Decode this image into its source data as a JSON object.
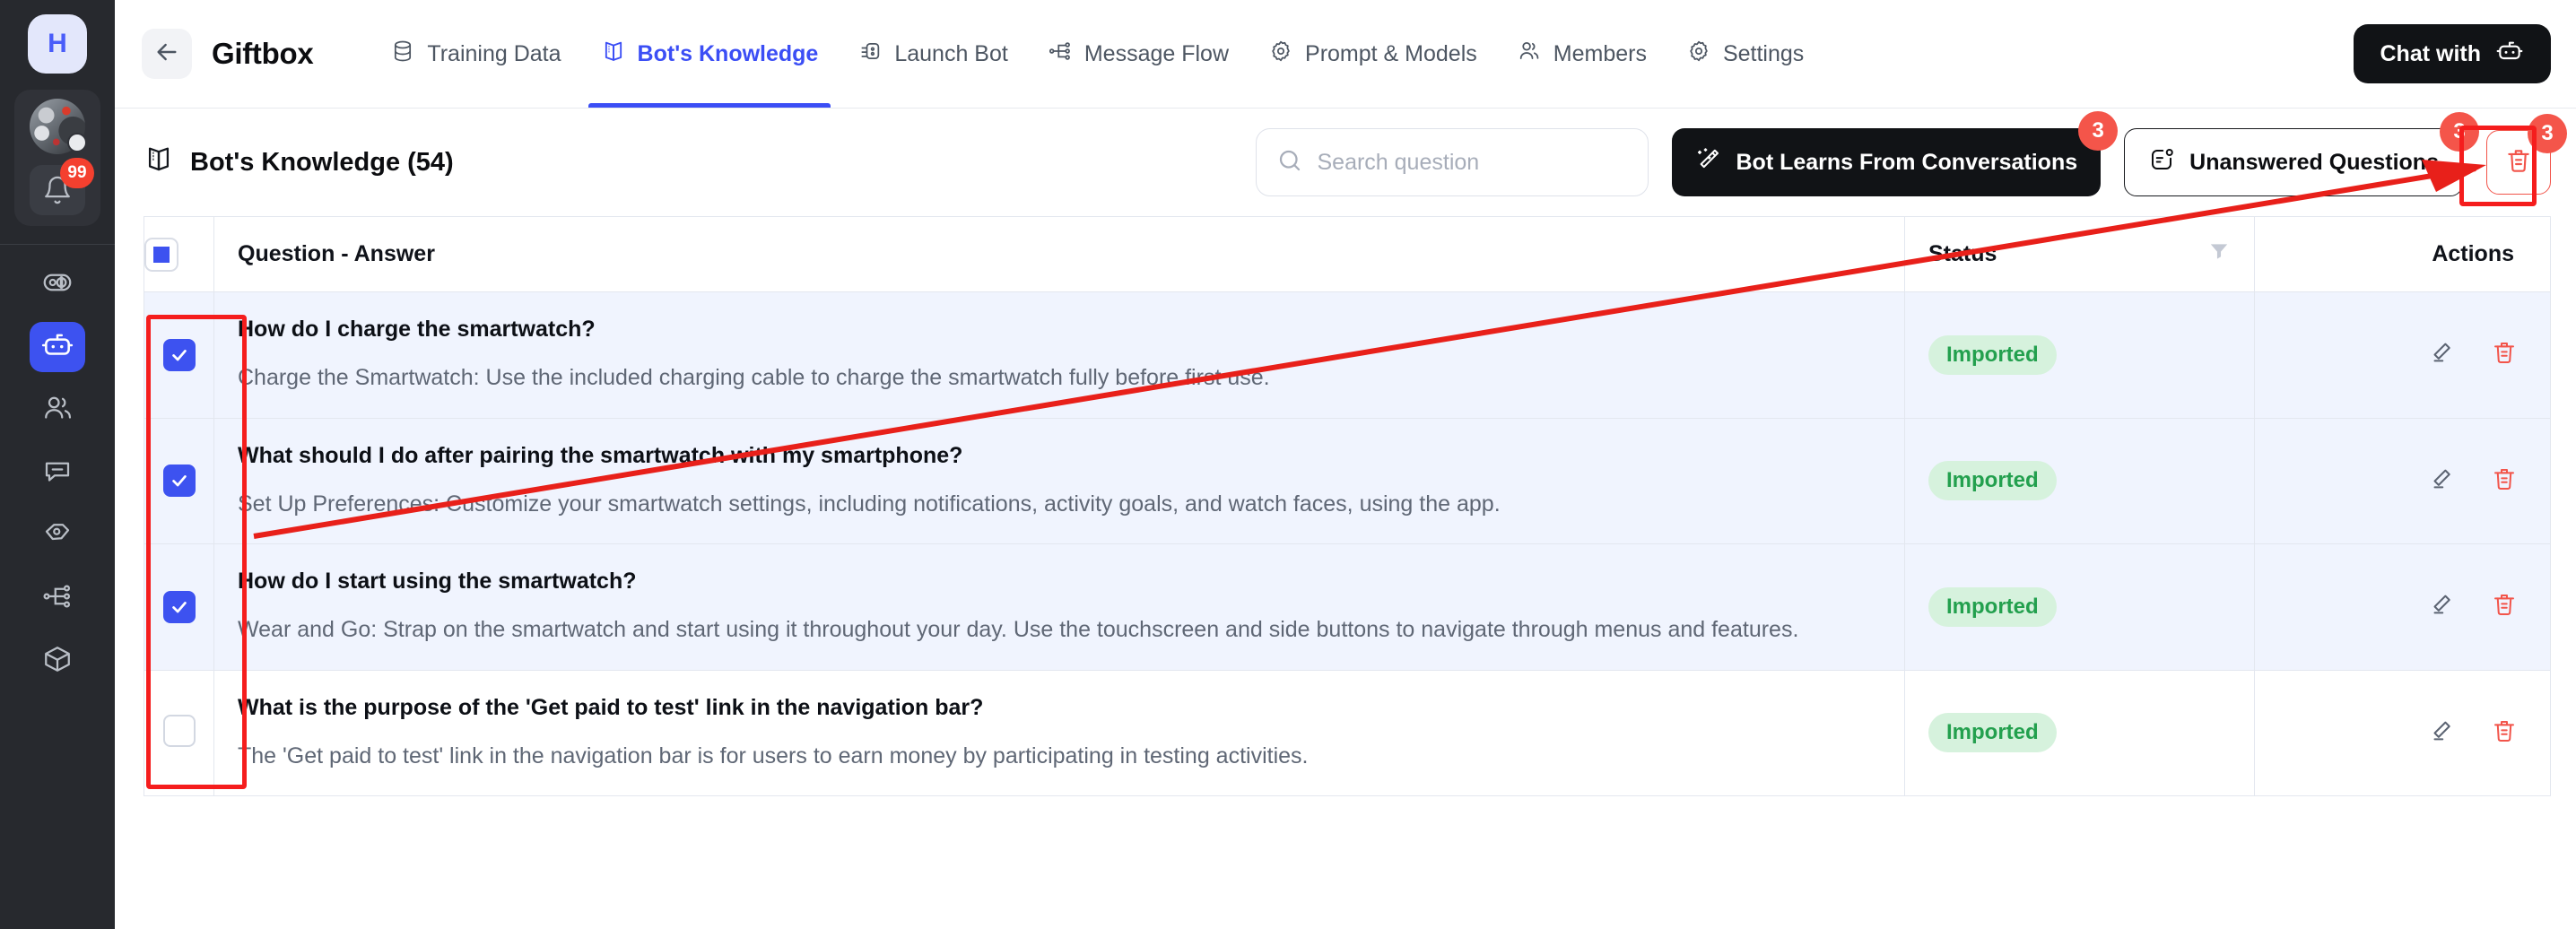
{
  "rail": {
    "logo_letter": "H",
    "notification_count": "99",
    "items": [
      {
        "name": "dashboard",
        "icon": "gauge-icon"
      },
      {
        "name": "bots",
        "icon": "robot-icon",
        "active": true
      },
      {
        "name": "contacts",
        "icon": "users-icon"
      },
      {
        "name": "conversations",
        "icon": "chat-bubble-icon"
      },
      {
        "name": "tags",
        "icon": "tag-icon"
      },
      {
        "name": "flows",
        "icon": "flow-icon"
      },
      {
        "name": "integrations",
        "icon": "box-icon"
      }
    ]
  },
  "topbar": {
    "back_label": "back-arrow",
    "brand": "Giftbox",
    "tabs": [
      {
        "label": "Training Data",
        "icon": "database-icon",
        "active": false
      },
      {
        "label": "Bot's Knowledge",
        "icon": "book-icon",
        "active": true
      },
      {
        "label": "Launch Bot",
        "icon": "launch-bot-icon",
        "active": false
      },
      {
        "label": "Message Flow",
        "icon": "flow-icon",
        "active": false
      },
      {
        "label": "Prompt & Models",
        "icon": "gear-icon",
        "active": false
      },
      {
        "label": "Members",
        "icon": "users-icon",
        "active": false
      },
      {
        "label": "Settings",
        "icon": "gear-icon",
        "active": false
      }
    ],
    "chat_button": "Chat with"
  },
  "toolbar": {
    "page_title": "Bot's Knowledge (54)",
    "search_placeholder": "Search question",
    "search_value": "",
    "bot_learns_label": "Bot Learns From Conversations",
    "bot_learns_badge": "3",
    "unanswered_label": "Unanswered Questions",
    "unanswered_badge": "3",
    "delete_badge": "3"
  },
  "table": {
    "headers": {
      "checkbox": "select-all",
      "question_answer": "Question - Answer",
      "status": "Status",
      "actions": "Actions"
    },
    "rows": [
      {
        "selected": true,
        "question": "How do I charge the smartwatch?",
        "answer": "Charge the Smartwatch: Use the included charging cable to charge the smartwatch fully before first use.",
        "status": "Imported"
      },
      {
        "selected": true,
        "question": "What should I do after pairing the smartwatch with my smartphone?",
        "answer": "Set Up Preferences: Customize your smartwatch settings, including notifications, activity goals, and watch faces, using the app.",
        "status": "Imported"
      },
      {
        "selected": true,
        "question": "How do I start using the smartwatch?",
        "answer": "Wear and Go: Strap on the smartwatch and start using it throughout your day. Use the touchscreen and side buttons to navigate through menus and features.",
        "status": "Imported"
      },
      {
        "selected": false,
        "question": "What is the purpose of the 'Get paid to test' link in the navigation bar?",
        "answer": "The 'Get paid to test' link in the navigation bar is for users to earn money by participating in testing activities.",
        "status": "Imported"
      }
    ]
  },
  "colors": {
    "accent": "#3d52f0",
    "danger": "#f4554a",
    "badge_green_bg": "#d6f2dd",
    "badge_green_text": "#23a04e",
    "row_selected_bg": "#f0f4fe",
    "annotation": "#f51d1d"
  }
}
